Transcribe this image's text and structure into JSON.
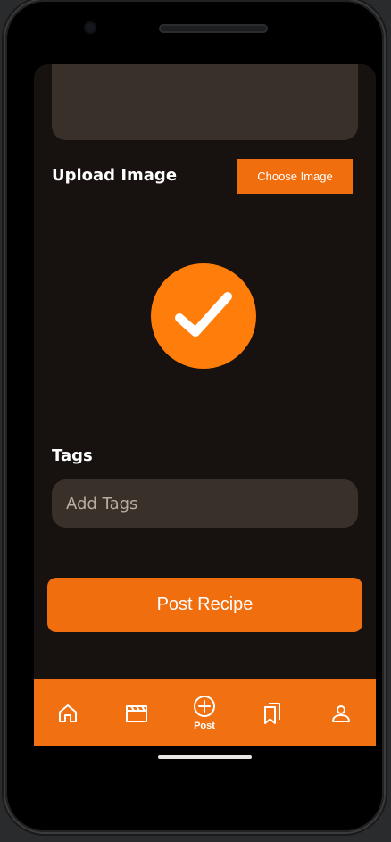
{
  "form": {
    "upload_label": "Upload Image",
    "choose_button": "Choose Image",
    "tags_label": "Tags",
    "tags_placeholder": "Add Tags",
    "post_button": "Post Recipe"
  },
  "nav": {
    "items": [
      {
        "icon": "home-icon",
        "label": ""
      },
      {
        "icon": "clapperboard-icon",
        "label": ""
      },
      {
        "icon": "plus-circle-icon",
        "label": "Post"
      },
      {
        "icon": "bookmarks-icon",
        "label": ""
      },
      {
        "icon": "user-icon",
        "label": ""
      }
    ]
  },
  "colors": {
    "accent": "#f06e0e",
    "background": "#17120f",
    "input_bg": "#3a302a"
  }
}
